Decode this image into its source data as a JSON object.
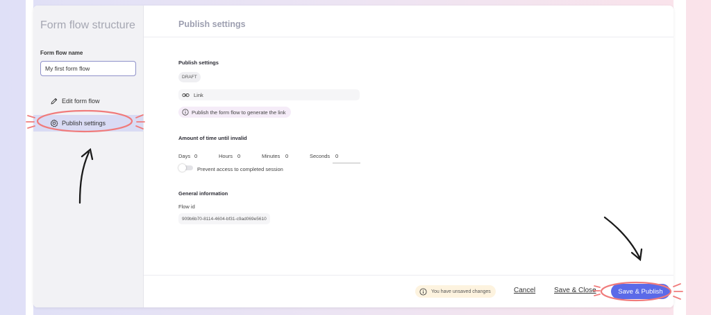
{
  "sidebar": {
    "title": "Form flow structure",
    "name_label": "Form flow name",
    "name_value": "My first form flow",
    "items": [
      {
        "label": "Edit form flow",
        "icon": "pencil-icon"
      },
      {
        "label": "Publish settings",
        "icon": "gear-icon"
      }
    ]
  },
  "main": {
    "title": "Publish settings",
    "publish": {
      "heading": "Publish settings",
      "status_badge": "DRAFT",
      "link_label": "Link",
      "link_hint": "Publish the form flow to generate the link"
    },
    "time": {
      "heading": "Amount of time until invalid",
      "fields": [
        {
          "label": "Days",
          "value": "0"
        },
        {
          "label": "Hours",
          "value": "0"
        },
        {
          "label": "Minutes",
          "value": "0"
        },
        {
          "label": "Seconds",
          "value": "0"
        }
      ],
      "toggle_label": "Prevent access to completed session",
      "toggle_on": false
    },
    "general": {
      "heading": "General information",
      "flow_id_label": "Flow id",
      "flow_id_value": "909b6b70-8114-4604-bf31-c9ad069e5610"
    }
  },
  "footer": {
    "unsaved_text": "You have unsaved changes",
    "cancel_label": "Cancel",
    "save_close_label": "Save & Close",
    "publish_label": "Save & Publish"
  },
  "colors": {
    "accent": "#5b6ae8",
    "annotation": "#f07b7b",
    "active_item": "#d9dbf4"
  }
}
